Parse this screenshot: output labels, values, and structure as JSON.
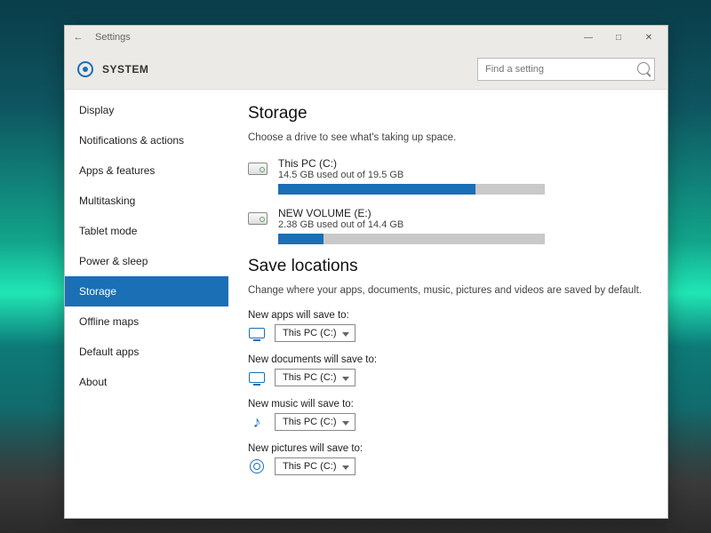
{
  "window": {
    "app_title": "Settings",
    "section": "SYSTEM",
    "search_placeholder": "Find a setting"
  },
  "sidebar": {
    "items": [
      {
        "label": "Display"
      },
      {
        "label": "Notifications & actions"
      },
      {
        "label": "Apps & features"
      },
      {
        "label": "Multitasking"
      },
      {
        "label": "Tablet mode"
      },
      {
        "label": "Power & sleep"
      },
      {
        "label": "Storage"
      },
      {
        "label": "Offline maps"
      },
      {
        "label": "Default apps"
      },
      {
        "label": "About"
      }
    ],
    "selected_index": 6
  },
  "storage": {
    "heading": "Storage",
    "description": "Choose a drive to see what's taking up space.",
    "drives": [
      {
        "name": "This PC (C:)",
        "used_text": "14.5 GB used out of 19.5 GB",
        "fill_pct": 74
      },
      {
        "name": "NEW VOLUME (E:)",
        "used_text": "2.38 GB used out of 14.4 GB",
        "fill_pct": 17
      }
    ]
  },
  "save_locations": {
    "heading": "Save locations",
    "description": "Change where your apps, documents, music, pictures and videos are saved by default.",
    "items": [
      {
        "label": "New apps will save to:",
        "value": "This PC (C:)",
        "icon": "monitor"
      },
      {
        "label": "New documents will save to:",
        "value": "This PC (C:)",
        "icon": "monitor"
      },
      {
        "label": "New music will save to:",
        "value": "This PC (C:)",
        "icon": "music"
      },
      {
        "label": "New pictures will save to:",
        "value": "This PC (C:)",
        "icon": "camera"
      }
    ]
  }
}
